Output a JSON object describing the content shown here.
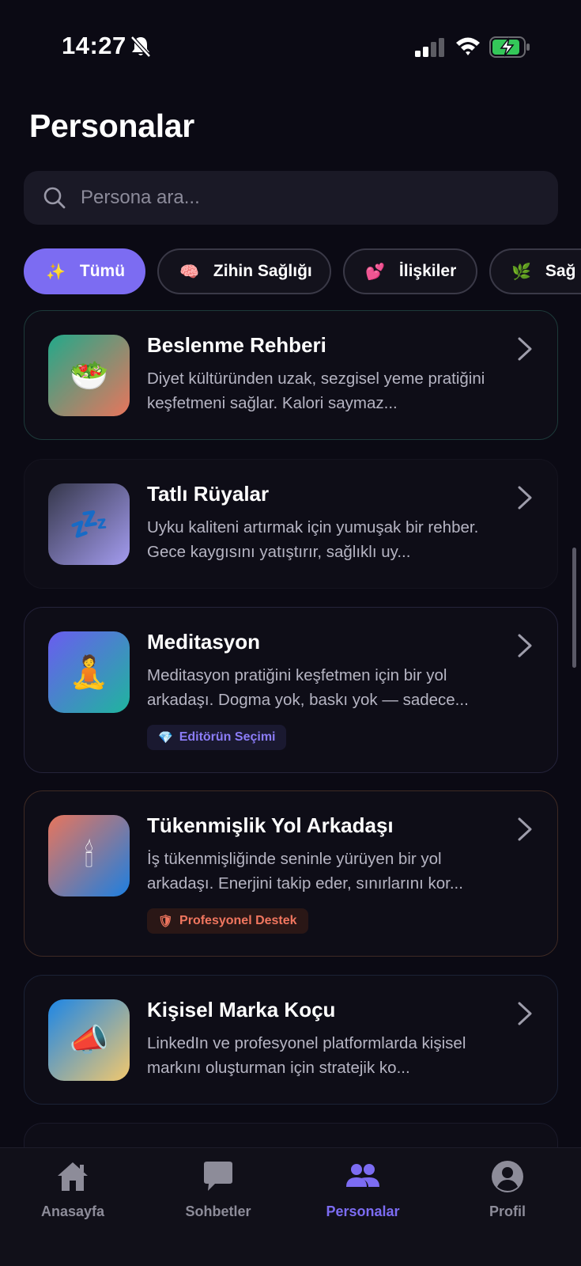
{
  "status": {
    "time": "14:27"
  },
  "header": {
    "title": "Personalar"
  },
  "search": {
    "placeholder": "Persona ara..."
  },
  "filters": [
    {
      "emoji": "✨",
      "label": "Tümü",
      "active": true
    },
    {
      "emoji": "🧠",
      "label": "Zihin Sağlığı",
      "active": false
    },
    {
      "emoji": "💕",
      "label": "İlişkiler",
      "active": false
    },
    {
      "emoji": "🌿",
      "label": "Sağ",
      "active": false
    }
  ],
  "personas": [
    {
      "title": "Beslenme Rehberi",
      "description": "Diyet kültüründen uzak, sezgisel yeme pratiğini keşfetmeni sağlar. Kalori saymaz...",
      "emoji": "🥗",
      "badge": null
    },
    {
      "title": "Tatlı Rüyalar",
      "description": "Uyku kaliteni artırmak için yumuşak bir rehber. Gece kaygısını yatıştırır, sağlıklı uy...",
      "emoji": "💤",
      "badge": null
    },
    {
      "title": "Meditasyon",
      "description": "Meditasyon pratiğini keşfetmen için bir yol arkadaşı. Dogma yok, baskı yok — sadece...",
      "emoji": "🧘",
      "badge": {
        "emoji": "💎",
        "label": "Editörün Seçimi",
        "color": "#8b7cf6"
      }
    },
    {
      "title": "Tükenmişlik Yol Arkadaşı",
      "description": "İş tükenmişliğinde seninle yürüyen bir yol arkadaşı. Enerjini takip eder, sınırlarını kor...",
      "emoji": "🕯",
      "badge": {
        "emoji": "🛡",
        "label": "Profesyonel Destek",
        "color": "#f0765f"
      }
    },
    {
      "title": "Kişisel Marka Koçu",
      "description": "LinkedIn ve profesyonel platformlarda kişisel markını oluşturman için stratejik ko...",
      "emoji": "📣",
      "badge": null
    }
  ],
  "nav": [
    {
      "label": "Anasayfa",
      "icon": "home-icon",
      "active": false
    },
    {
      "label": "Sohbetler",
      "icon": "chat-icon",
      "active": false
    },
    {
      "label": "Personalar",
      "icon": "users-icon",
      "active": true
    },
    {
      "label": "Profil",
      "icon": "profile-icon",
      "active": false
    }
  ],
  "colors": {
    "background": "#0b0a14",
    "accent": "#7c6cf2",
    "card_border_default": "#24233a"
  }
}
